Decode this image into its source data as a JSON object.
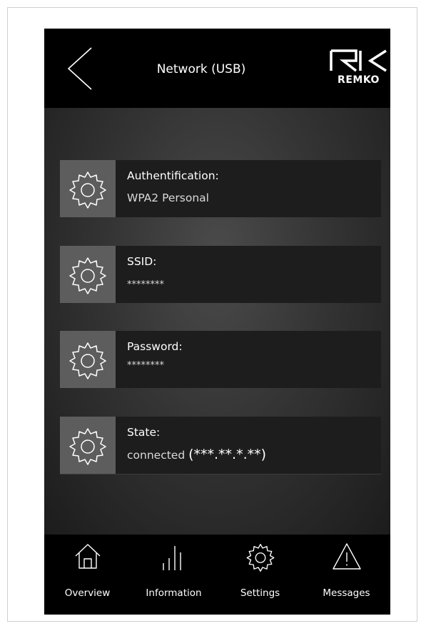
{
  "header": {
    "title": "Network (USB)",
    "back_icon": "chevron-left-icon",
    "logo_text": "REMKO"
  },
  "settings": [
    {
      "label": "Authentification:",
      "value": "WPA2 Personal",
      "icon": "gear-icon"
    },
    {
      "label": "SSID:",
      "value": "********",
      "icon": "gear-icon"
    },
    {
      "label": "Password:",
      "value": "********",
      "icon": "gear-icon"
    },
    {
      "label": "State:",
      "value": "connected",
      "ip": "(***.**.*.**)",
      "icon": "gear-icon"
    }
  ],
  "nav": [
    {
      "label": "Overview",
      "icon": "home-icon"
    },
    {
      "label": "Information",
      "icon": "bars-icon"
    },
    {
      "label": "Settings",
      "icon": "gear-icon"
    },
    {
      "label": "Messages",
      "icon": "warning-icon"
    }
  ],
  "colors": {
    "screen_bg": "#000000",
    "icon_box": "#5d5d5d",
    "row_bg": "#1d1d1d",
    "text": "#ffffff"
  }
}
